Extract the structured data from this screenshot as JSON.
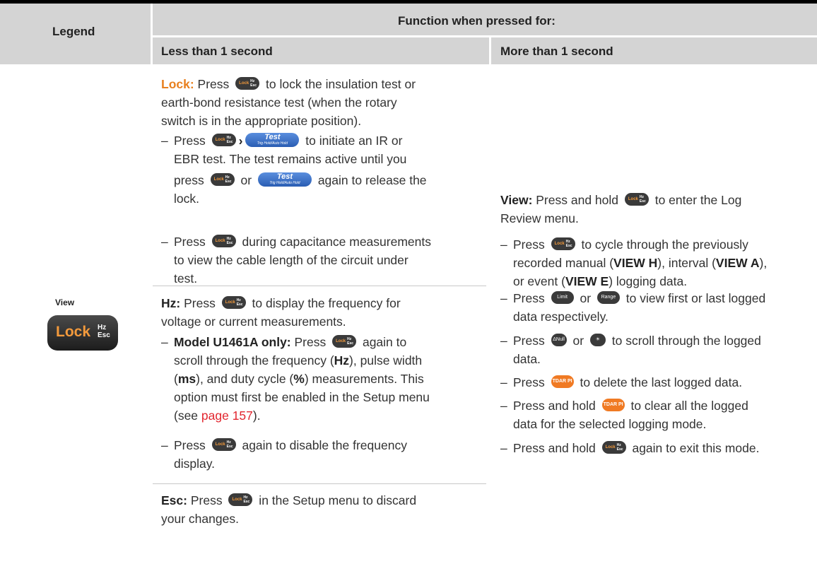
{
  "header": {
    "legend": "Legend",
    "function": "Function when pressed for:",
    "less": "Less than 1 second",
    "more": "More than 1 second"
  },
  "legend": {
    "view_label": "View",
    "key_lock": "Lock",
    "key_hz": "Hz",
    "key_esc": "Esc"
  },
  "keys": {
    "lock": "Lock",
    "hz": "Hz",
    "esc": "Esc",
    "test": "Test",
    "test_sub": "Trig Hold/Auto Hold",
    "limit": "Limit",
    "range": "Range",
    "null": "ΔNull",
    "tdarpi": "TDAR PI"
  },
  "lock": {
    "heading": "Lock:",
    "line1": " Press ",
    "line1b": " to lock the insulation test or",
    "line2": "earth-bond resistance test (when the rotary",
    "line3": "switch is in the appropriate position).",
    "b1_press": "Press ",
    "b1_arrow": "›",
    "b1_rest": " to initiate an IR or",
    "b1_line2": "EBR test. The test remains active until you",
    "b1_line3a": "press ",
    "b1_line3b": " or ",
    "b1_line3c": " again to release the",
    "b1_line4": "lock.",
    "b2_press": "Press ",
    "b2_rest": " during capacitance measurements",
    "b2_line2": "to view the cable length of the circuit under",
    "b2_line3": "test."
  },
  "hz": {
    "heading": "Hz:",
    "line1a": " Press ",
    "line1b": " to display the frequency for",
    "line2": "voltage or current measurements.",
    "b1_model": "Model U1461A only:",
    "b1_press": " Press ",
    "b1_rest": " again to",
    "b1_l2a": "scroll through the frequency (",
    "b1_l2b": "Hz",
    "b1_l2c": "), pulse width",
    "b1_l3a": "(",
    "b1_l3b": "ms",
    "b1_l3c": "), and duty cycle (",
    "b1_l3d": "%",
    "b1_l3e": ") measurements. This",
    "b1_l4": "option must first be enabled in the Setup menu",
    "b1_l5a": "(see ",
    "b1_l5b": "page 157",
    "b1_l5c": ").",
    "b2_press": "Press ",
    "b2_rest": " again to disable the frequency",
    "b2_line2": "display."
  },
  "esc": {
    "heading": "Esc:",
    "line1a": " Press ",
    "line1b": " in the Setup menu to discard",
    "line2": "your changes."
  },
  "view": {
    "heading": "View:",
    "line1a": " Press and hold ",
    "line1b": " to enter the Log",
    "line2": "Review menu.",
    "b1a": "Press ",
    "b1b": " to cycle through the previously",
    "b1_l2a": "recorded manual (",
    "b1_l2b": "VIEW H",
    "b1_l2c": "), interval (",
    "b1_l2d": "VIEW A",
    "b1_l2e": "),",
    "b1_l3a": "or event (",
    "b1_l3b": "VIEW E",
    "b1_l3c": ") logging data.",
    "b2a": "Press ",
    "b2b": " or ",
    "b2c": " to view first or last logged",
    "b2_l2": "data respectively.",
    "b3a": "Press ",
    "b3b": " or ",
    "b3c": " to scroll through the logged",
    "b3_l2": "data.",
    "b4a": "Press ",
    "b4b": " to delete the last logged data.",
    "b5a": "Press and hold ",
    "b5b": " to clear all the logged",
    "b5_l2": "data for the selected logging mode.",
    "b6a": "Press and hold ",
    "b6b": " again to exit this mode."
  },
  "dash": "–"
}
